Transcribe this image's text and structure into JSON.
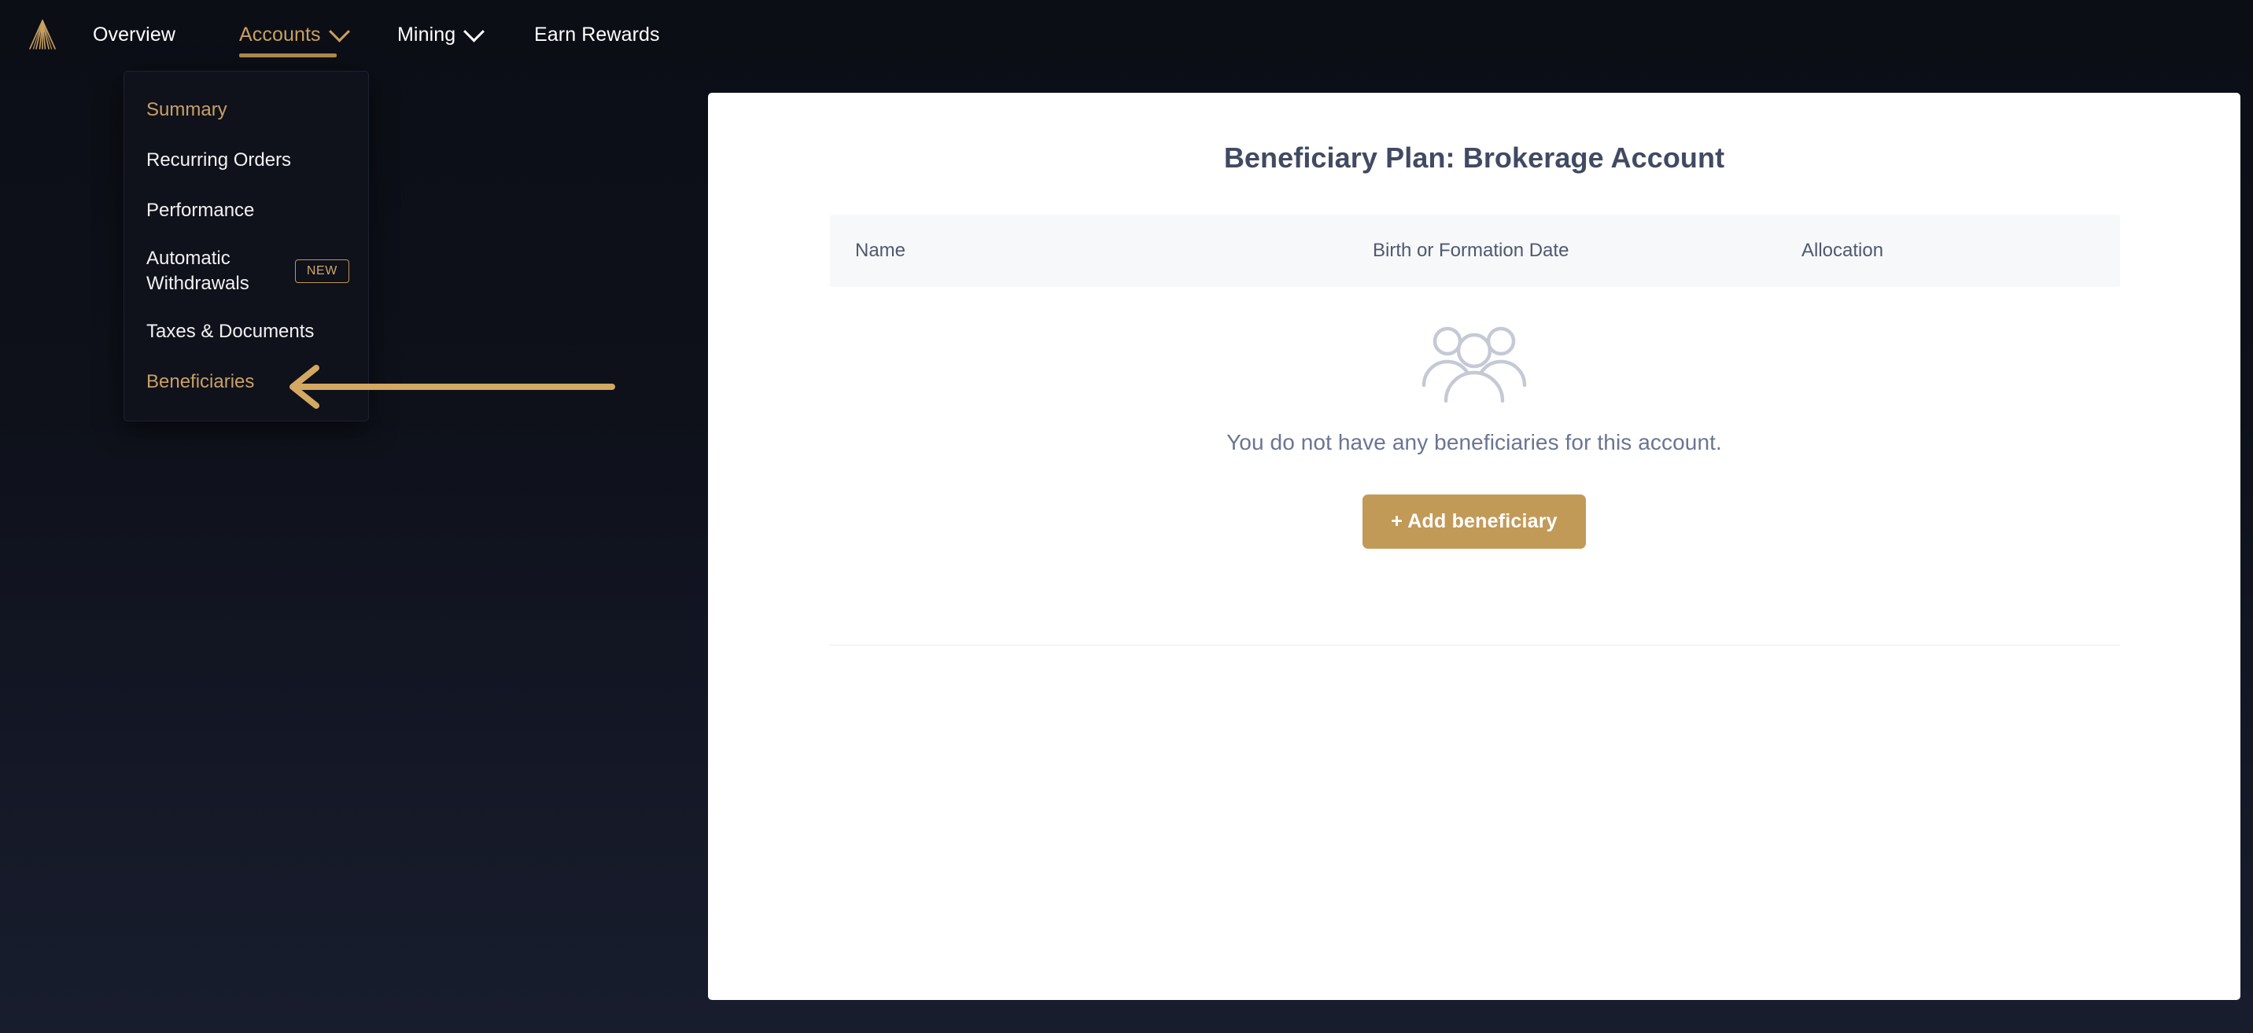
{
  "navbar": {
    "logo_icon": "pyramid-logo-icon",
    "items": [
      {
        "label": "Overview",
        "active": false,
        "has_caret": false
      },
      {
        "label": "Accounts",
        "active": true,
        "has_caret": true
      },
      {
        "label": "Mining",
        "active": false,
        "has_caret": true
      },
      {
        "label": "Earn Rewards",
        "active": false,
        "has_caret": false
      }
    ]
  },
  "dropdown": {
    "open_for": "Accounts",
    "items": [
      {
        "label": "Summary",
        "highlighted": true,
        "badge": ""
      },
      {
        "label": "Recurring Orders",
        "highlighted": false,
        "badge": ""
      },
      {
        "label": "Performance",
        "highlighted": false,
        "badge": ""
      },
      {
        "label": "Automatic Withdrawals",
        "highlighted": false,
        "badge": "NEW"
      },
      {
        "label": "Taxes & Documents",
        "highlighted": false,
        "badge": ""
      },
      {
        "label": "Beneficiaries",
        "highlighted": true,
        "badge": ""
      }
    ]
  },
  "annotation": {
    "type": "left-pointing-arrow",
    "points_to": "Beneficiaries",
    "color": "#d2a862"
  },
  "card": {
    "title": "Beneficiary Plan: Brokerage Account",
    "table": {
      "columns": [
        "Name",
        "Birth or Formation Date",
        "Allocation"
      ],
      "rows": []
    },
    "empty_state": {
      "icon": "group-of-people-icon",
      "message": "You do not have any beneficiaries for this account.",
      "action_label": "+ Add beneficiary"
    }
  },
  "colors": {
    "accent_gold": "#c9a063",
    "button_gold": "#c29a58",
    "page_background": "#0e111a",
    "card_background": "#ffffff",
    "table_header_background": "#f7f8fa",
    "title_text": "#414a63",
    "muted_text": "#6b7493"
  }
}
